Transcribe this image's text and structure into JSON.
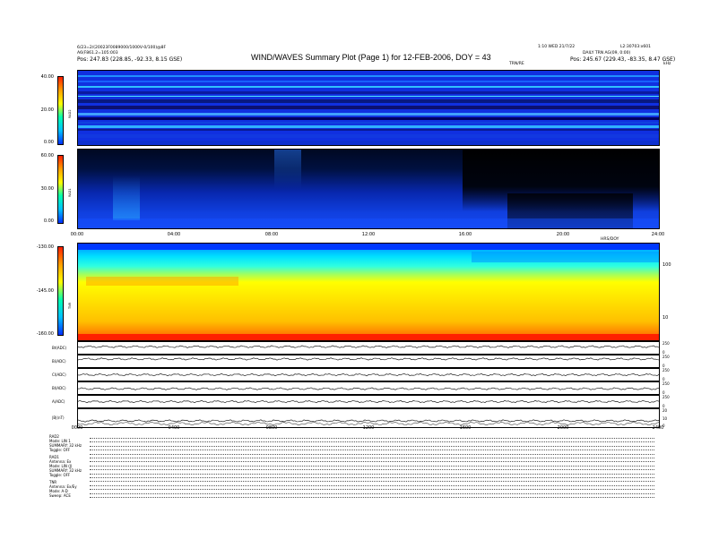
{
  "header": {
    "title": "WIND/WAVES Summary Plot (Page 1) for 12-FEB-2006, DOY = 43",
    "left_line1": "6/23=2/(20023F0089000/1000V-0/100)@8F",
    "left_line2": "A6(F861.2=105:003",
    "left_line3": "Pos: 247.83 (228.85, -92.33, 8.15 GSE)",
    "right_line1": "1:10 WED 21/7/22",
    "right_line1b": "L2:30703:x601",
    "right_line2": "DAILY TRN AG(09, 0:00)",
    "right_line3": "Pos: 245.67 (229.43, -83.35, 8.47 GSE)",
    "trn_label": "TRN/RE",
    "khz_label": "kHz",
    "hours_label": "HRS/DOY"
  },
  "colors": {
    "background": "#ffffff",
    "spectrogram_low": "#0a20d0",
    "spectrogram_high": "#ff2000",
    "accent_cyan": "#00e0ff",
    "accent_yellow": "#ffe000"
  },
  "chart_data": [
    {
      "type": "heatmap",
      "name": "RAD2",
      "ylabel": "RAD2",
      "colorbar_ticks": [
        "40.00",
        "20.00",
        "0.00"
      ],
      "colorbar_range": [
        0,
        40
      ]
    },
    {
      "type": "heatmap",
      "name": "RAD1",
      "ylabel": "RAD1",
      "colorbar_ticks": [
        "60.00",
        "30.00",
        "0.00"
      ],
      "colorbar_range": [
        0,
        60
      ]
    },
    {
      "type": "heatmap",
      "name": "TNR",
      "ylabel": "TNR",
      "colorbar_ticks": [
        "-130.00",
        "-145.00",
        "-160.00"
      ],
      "colorbar_range": [
        -160,
        -130
      ],
      "right_ticks": [
        "100",
        "10"
      ],
      "x_ticks": [
        "00:00",
        "04:00",
        "08:00",
        "12:00",
        "16:00",
        "20:00",
        "24:00"
      ]
    },
    {
      "type": "line",
      "name": "Magnetic field",
      "x_ticks": [
        "0000",
        "0400",
        "0800",
        "1200",
        "1600",
        "2000",
        "2400"
      ],
      "panels": [
        {
          "label": "Bt(ADC)",
          "right_ticks": [
            "250",
            "0"
          ],
          "level": 0.6
        },
        {
          "label": "Bi(ADC)",
          "right_ticks": [
            "250",
            "0"
          ],
          "level": 0.7
        },
        {
          "label": "Cl(ADC)",
          "right_ticks": [
            "250",
            "0"
          ],
          "level": 0.5
        },
        {
          "label": "Bl(ADC)",
          "right_ticks": [
            "250",
            "0"
          ],
          "level": 0.45
        },
        {
          "label": "A(ADC)",
          "right_ticks": [
            "250",
            "0"
          ],
          "level": 0.5
        },
        {
          "label": "|B|(nT)",
          "right_ticks": [
            "20",
            "10",
            "0"
          ],
          "level": 0.35
        }
      ]
    }
  ],
  "config": {
    "rad2_block": [
      "RAD2",
      "Mode: LIN 1",
      "SUMMARY: 32 kHz",
      "Toggle: OFF"
    ],
    "rad1_block": [
      "RAD1",
      "Antenna: Ex",
      "Mode: LIN (J)",
      "SUMMARY: 32 kHz",
      "Toggle: OFF"
    ],
    "tnr_block": [
      "TNR",
      "Antenna: Ex/Ey",
      "Mode: A-D",
      "Sweep: ACE"
    ]
  }
}
